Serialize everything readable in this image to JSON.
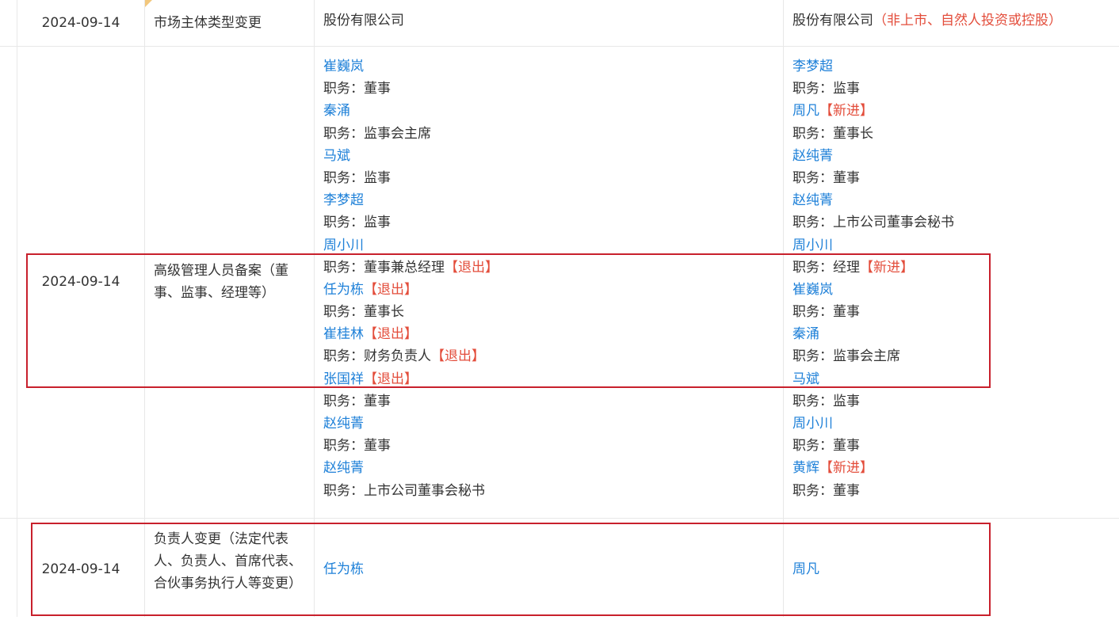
{
  "rows": [
    {
      "date": "2024-09-14",
      "type": "市场主体类型变更",
      "before": "股份有限公司",
      "after": "股份有限公司",
      "after_note": "（非上市、自然人投资或控股）"
    },
    {
      "date": "2024-09-14",
      "type": "高级管理人员备案（董事、监事、经理等）",
      "before": [
        {
          "name": "崔巍岚",
          "role": "职务：董事",
          "name_tag": "",
          "role_tag": ""
        },
        {
          "name": "秦涌",
          "role": "职务：监事会主席",
          "name_tag": "",
          "role_tag": ""
        },
        {
          "name": "马斌",
          "role": "职务：监事",
          "name_tag": "",
          "role_tag": ""
        },
        {
          "name": "李梦超",
          "role": "职务：监事",
          "name_tag": "",
          "role_tag": ""
        },
        {
          "name": "周小川",
          "role": "职务：董事兼总经理",
          "name_tag": "",
          "role_tag": "【退出】"
        },
        {
          "name": "任为栋",
          "role": "职务：董事长",
          "name_tag": "【退出】",
          "role_tag": ""
        },
        {
          "name": "崔桂林",
          "role": "职务：财务负责人",
          "name_tag": "【退出】",
          "role_tag": "【退出】"
        },
        {
          "name": "张国祥",
          "role": "职务：董事",
          "name_tag": "【退出】",
          "role_tag": ""
        },
        {
          "name": "赵纯菁",
          "role": "职务：董事",
          "name_tag": "",
          "role_tag": ""
        },
        {
          "name": "赵纯菁",
          "role": "职务：上市公司董事会秘书",
          "name_tag": "",
          "role_tag": ""
        }
      ],
      "after": [
        {
          "name": "李梦超",
          "role": "职务：监事",
          "name_tag": "",
          "role_tag": ""
        },
        {
          "name": "周凡",
          "role": "职务：董事长",
          "name_tag": "【新进】",
          "role_tag": ""
        },
        {
          "name": "赵纯菁",
          "role": "职务：董事",
          "name_tag": "",
          "role_tag": ""
        },
        {
          "name": "赵纯菁",
          "role": "职务：上市公司董事会秘书",
          "name_tag": "",
          "role_tag": ""
        },
        {
          "name": "周小川",
          "role": "职务：经理",
          "name_tag": "",
          "role_tag": "【新进】"
        },
        {
          "name": "崔巍岚",
          "role": "职务：董事",
          "name_tag": "",
          "role_tag": ""
        },
        {
          "name": "秦涌",
          "role": "职务：监事会主席",
          "name_tag": "",
          "role_tag": ""
        },
        {
          "name": "马斌",
          "role": "职务：监事",
          "name_tag": "",
          "role_tag": ""
        },
        {
          "name": "周小川",
          "role": "职务：董事",
          "name_tag": "",
          "role_tag": ""
        },
        {
          "name": "黄辉",
          "role": "职务：董事",
          "name_tag": "【新进】",
          "role_tag": ""
        }
      ]
    },
    {
      "date": "2024-09-14",
      "type": "负责人变更（法定代表人、负责人、首席代表、合伙事务执行人等变更）",
      "before": "任为栋",
      "after": "周凡"
    }
  ],
  "colors": {
    "link": "#1e80d8",
    "tag": "#e34d3b",
    "highlight_border": "#c8202c",
    "grid": "#e8e8e8"
  }
}
